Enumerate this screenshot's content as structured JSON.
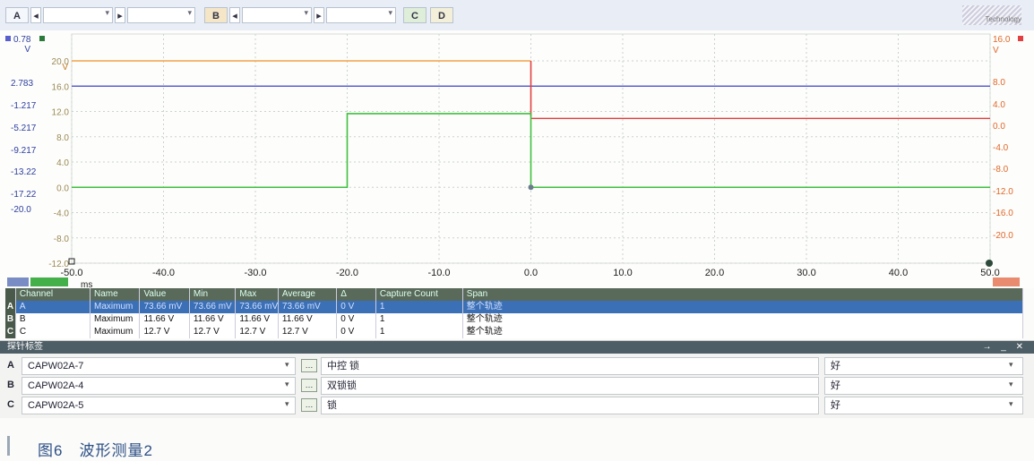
{
  "toolbar": {
    "channel_a": "A",
    "channel_b": "B",
    "channel_c": "C",
    "channel_d": "D",
    "nav_prev": "◂",
    "nav_next": "▸",
    "logo_text": "Technology"
  },
  "chart": {
    "left_axis_a": {
      "top_value": "0.78",
      "unit": "V",
      "ticks": [
        "2.783",
        "-1.217",
        "-5.217",
        "-9.217",
        "-13.22",
        "-17.22",
        "-20.0"
      ]
    },
    "left_axis_b": {
      "unit": "V",
      "ticks": [
        "20.0",
        "16.0",
        "12.0",
        "8.0",
        "4.0",
        "0.0",
        "-4.0",
        "-8.0",
        "-12.0"
      ]
    },
    "right_axis": {
      "top_value": "16.0",
      "unit": "V",
      "ticks": [
        "8.0",
        "4.0",
        "0.0",
        "-4.0",
        "-8.0",
        "-12.0",
        "-16.0",
        "-20.0"
      ]
    },
    "x_axis": {
      "unit": "ms",
      "ticks": [
        "-50.0",
        "-40.0",
        "-30.0",
        "-20.0",
        "-10.0",
        "0.0",
        "10.0",
        "20.0",
        "30.0",
        "40.0",
        "50.0"
      ]
    },
    "colors": {
      "ch_a": "#5a5fd0",
      "ch_b_orange": "#f2a24a",
      "ch_red": "#e24040",
      "ch_c_green": "#3fbf3f",
      "grid": "#c9d3cf"
    }
  },
  "chart_data": {
    "type": "line",
    "xlabel": "ms",
    "xlim": [
      -50,
      50
    ],
    "ylim_left": [
      -12,
      20
    ],
    "series": [
      {
        "name": "A",
        "x": [
          -50,
          50
        ],
        "y": [
          16.0,
          16.0
        ]
      },
      {
        "name": "B",
        "x": [
          -50,
          0,
          0,
          50
        ],
        "y": [
          20.0,
          20.0,
          0.0,
          0.0
        ]
      },
      {
        "name": "C",
        "x": [
          -50,
          -20,
          -20,
          0,
          0,
          50
        ],
        "y": [
          0.0,
          0.0,
          11.66,
          11.66,
          0.0,
          0.0
        ]
      }
    ]
  },
  "table": {
    "headers": [
      "Channel",
      "Name",
      "Value",
      "Min",
      "Max",
      "Average",
      "Δ",
      "Capture Count",
      "Span"
    ],
    "rows": [
      {
        "marker": "A",
        "cells": [
          "A",
          "Maximum",
          "73.66 mV",
          "73.66 mV",
          "73.66 mV",
          "73.66 mV",
          "0 V",
          "1",
          "整个轨迹"
        ]
      },
      {
        "marker": "B",
        "cells": [
          "B",
          "Maximum",
          "11.66 V",
          "11.66 V",
          "11.66 V",
          "11.66 V",
          "0 V",
          "1",
          "整个轨迹"
        ]
      },
      {
        "marker": "C",
        "cells": [
          "C",
          "Maximum",
          "12.7 V",
          "12.7 V",
          "12.7 V",
          "12.7 V",
          "0 V",
          "1",
          "整个轨迹"
        ]
      }
    ]
  },
  "probe_panel": {
    "title": "探针标签",
    "controls": "→ _ ✕",
    "rows": [
      {
        "channel": "A",
        "connector": "CAPW02A-7",
        "label": "中控 锁",
        "status": "好"
      },
      {
        "channel": "B",
        "connector": "CAPW02A-4",
        "label": "双锁锁",
        "status": "好"
      },
      {
        "channel": "C",
        "connector": "CAPW02A-5",
        "label": "锁",
        "status": "好"
      }
    ]
  },
  "caption": "图6　波形测量2"
}
